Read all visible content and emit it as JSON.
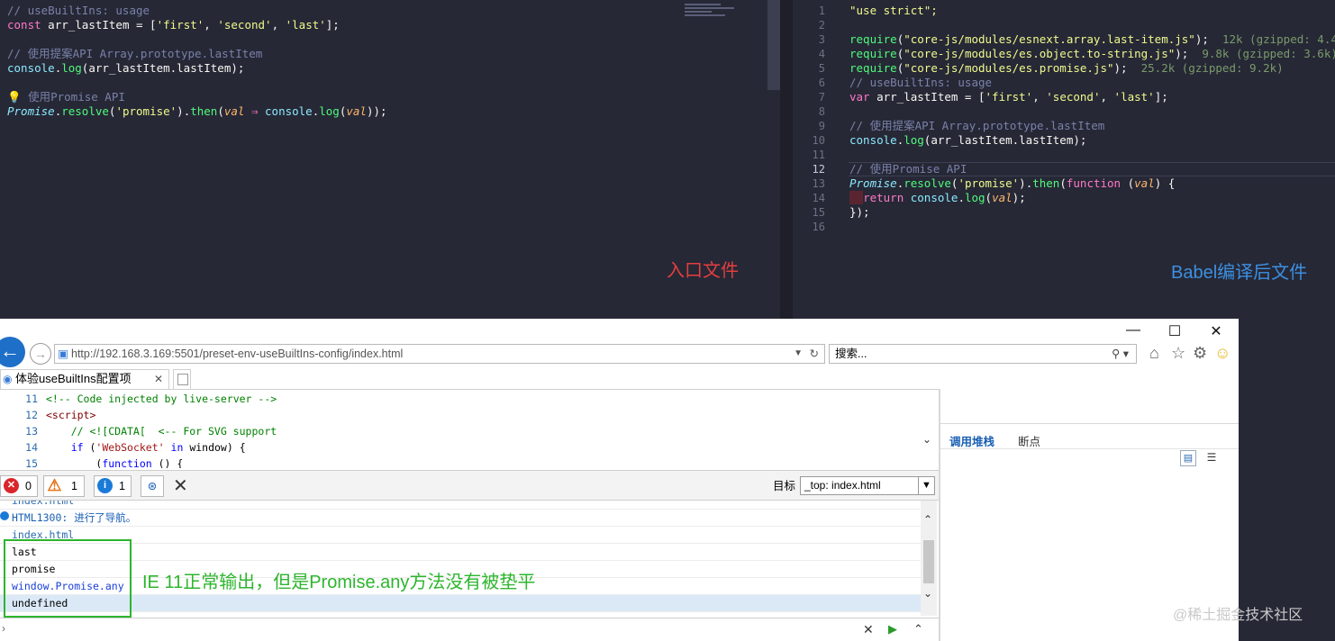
{
  "left_editor": {
    "lines": [
      {
        "type": "comment",
        "text": "// useBuiltIns: usage"
      },
      {
        "type": "decl",
        "kw": "const",
        "ident": "arr_lastItem",
        "eq": " = [",
        "s1": "'first'",
        "s2": "'second'",
        "s3": "'last'",
        "end": "];"
      },
      {
        "type": "blank"
      },
      {
        "type": "comment",
        "text": "// 使用提案API Array.prototype.lastItem"
      },
      {
        "type": "log",
        "obj": "console",
        "fn": "log",
        "arg": "(arr_lastItem.lastItem);"
      },
      {
        "type": "blank"
      },
      {
        "type": "comment",
        "text": "💡 使用Promise API"
      },
      {
        "type": "promise",
        "cls": "Promise",
        "fn1": "resolve",
        "s": "'promise'",
        "fn2": "then",
        "param": "val",
        "arrow": " ⇒ ",
        "obj": "console",
        "fn3": "log",
        "param2": "val",
        "end": "));"
      }
    ],
    "annotation": "入口文件"
  },
  "right_editor": {
    "line_numbers": [
      "1",
      "2",
      "3",
      "4",
      "5",
      "6",
      "7",
      "8",
      "9",
      "10",
      "11",
      "12",
      "13",
      "14",
      "15",
      "16"
    ],
    "strict": "\"use strict\";",
    "requires": [
      {
        "mod": "\"core-js/modules/esnext.array.last-item.js\"",
        "size": "12k (gzipped: 4.4k)"
      },
      {
        "mod": "\"core-js/modules/es.object.to-string.js\"",
        "size": "9.8k (gzipped: 3.6k)"
      },
      {
        "mod": "\"core-js/modules/es.promise.js\"",
        "size": "25.2k (gzipped: 9.2k)"
      }
    ],
    "require_kw": "require",
    "comment1": "// useBuiltIns: usage",
    "var_kw": "var",
    "var_rest": " arr_lastItem = [",
    "s1": "'first'",
    "s2": "'second'",
    "s3": "'last'",
    "var_end": "];",
    "comment2": "// 使用提案API Array.prototype.lastItem",
    "log_obj": "console",
    "log_fn": "log",
    "log_arg": "(arr_lastItem.lastItem);",
    "comment3": "// 使用Promise API",
    "p_cls": "Promise",
    "p_fn1": "resolve",
    "p_str": "'promise'",
    "p_fn2": "then",
    "p_kw": "function",
    "p_param": "val",
    "p_open": ") {",
    "ret_kw": "return",
    "ret_obj": "console",
    "ret_fn": "log",
    "ret_param": "val",
    "ret_end": ");",
    "close": "});",
    "annotation": "Babel编译后文件"
  },
  "ie": {
    "url_host": "http://192.168.3.169",
    "url_rest": ":5501/preset-env-useBuiltIns-config/index.html",
    "search_placeholder": "搜索...",
    "tab_title": "体验useBuiltIns配置项",
    "source_lines": [
      {
        "n": "11",
        "text": "<!-- Code injected by live-server -->"
      },
      {
        "n": "12",
        "text": "<script>"
      },
      {
        "n": "13",
        "text": "    // <![CDATA[  <-- For SVG support"
      },
      {
        "n": "14",
        "kw": "if",
        "str": "'WebSocket'",
        "kw2": "in",
        "rest": " window) {"
      },
      {
        "n": "15",
        "kw": "function",
        "rest": " () {"
      }
    ],
    "debug_tabs": [
      "调用堆栈",
      "断点"
    ],
    "counts": {
      "errors": "0",
      "warnings": "1",
      "info": "1"
    },
    "target_label": "目标",
    "target_value": "_top: index.html",
    "console_lines": [
      {
        "text": "index.html",
        "kind": "link"
      },
      {
        "text": "HTML1300: 进行了导航。",
        "kind": "info"
      },
      {
        "text": "index.html",
        "kind": "link"
      },
      {
        "text": "last",
        "kind": "plain"
      },
      {
        "text": "promise",
        "kind": "plain"
      },
      {
        "text": "window.Promise.any",
        "kind": "blue"
      },
      {
        "text": "undefined",
        "kind": "plain"
      }
    ],
    "annotation": "IE 11正常输出，但是Promise.any方法没有被垫平"
  },
  "watermark": "@稀土掘金技术社区"
}
